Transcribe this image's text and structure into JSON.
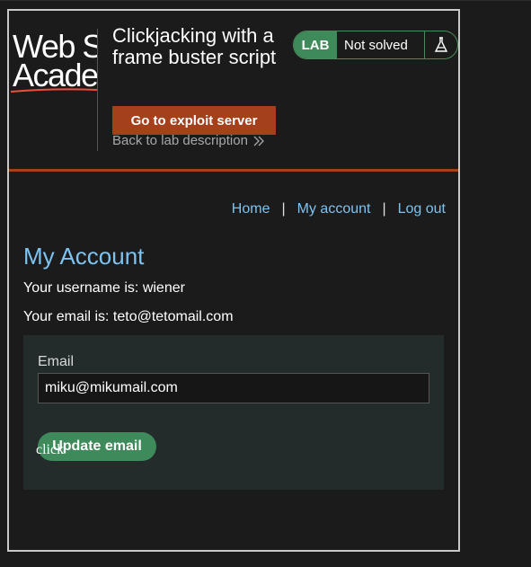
{
  "header": {
    "logo_line1": "Web Se",
    "logo_line2": "Acade",
    "lab_title": "Clickjacking with a frame buster script",
    "exploit_button": "Go to exploit server",
    "back_link": "Back to lab description",
    "lab_tag": "LAB",
    "lab_status": "Not solved"
  },
  "nav": {
    "home": "Home",
    "separator": "|",
    "my_account": "My account",
    "log_out": "Log out"
  },
  "main": {
    "page_title": "My Account",
    "username_line": "Your username is: wiener",
    "email_line": "Your email is: teto@tetomail.com",
    "form": {
      "email_label": "Email",
      "email_value": "miku@mikumail.com",
      "submit_label": "Update email"
    }
  },
  "decoy": {
    "text": "click"
  },
  "colors": {
    "accent_orange": "#a5401c",
    "lab_green": "#3f8a5a",
    "link_blue": "#7ec3f0",
    "background": "#1b1b1b"
  }
}
